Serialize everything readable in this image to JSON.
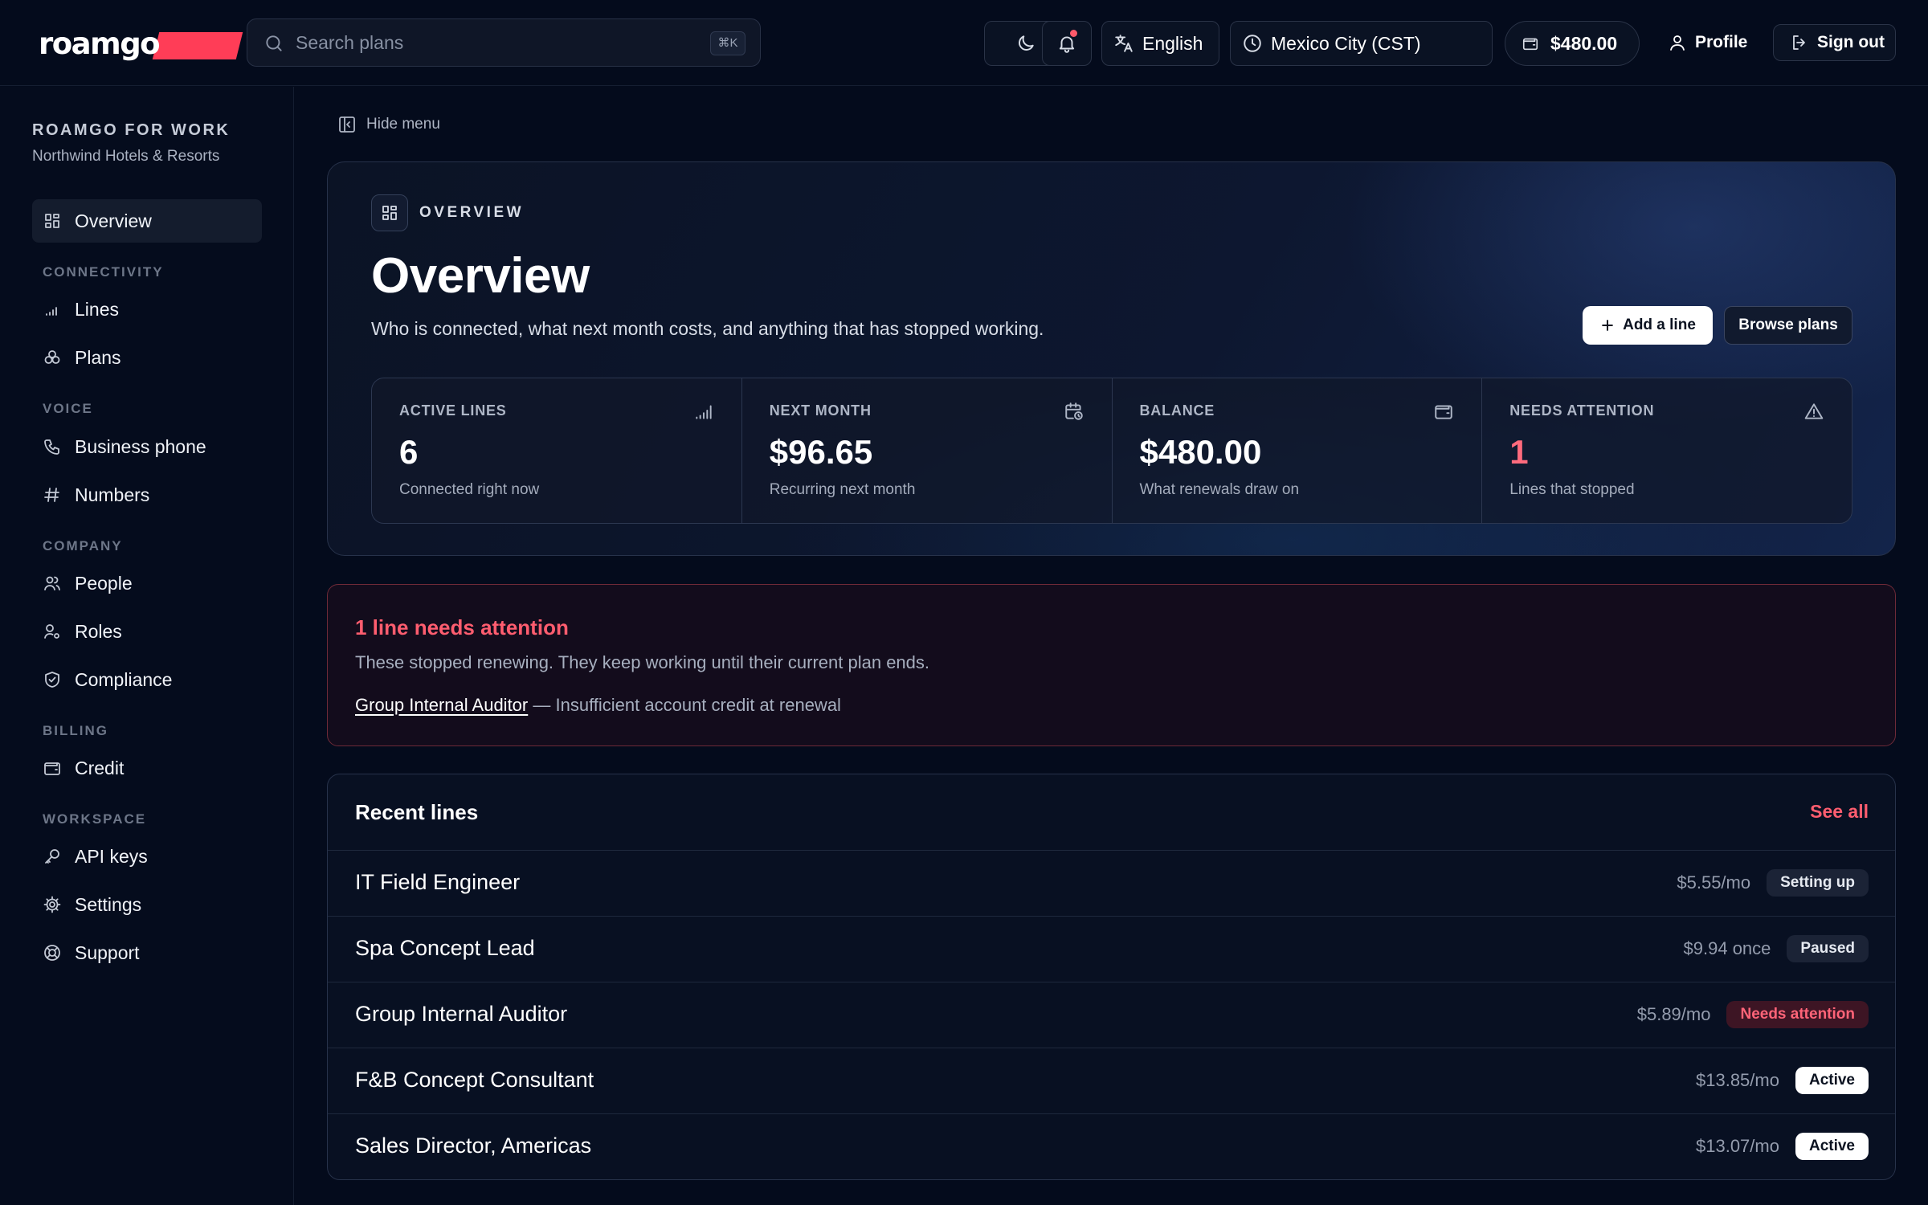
{
  "brand": {
    "logo_text": "roamgo",
    "accent": "#ff3d57"
  },
  "topbar": {
    "search_placeholder": "Search plans",
    "search_shortcut": "⌘K",
    "theme_toggle_icon": "moon-icon",
    "notifications_icon": "bell-icon",
    "language": "English",
    "timezone": "Mexico City (CST)",
    "balance": "$480.00",
    "profile_label": "Profile",
    "signout_label": "Sign out"
  },
  "sidebar": {
    "org_label": "ROAMGO FOR WORK",
    "org_name": "Northwind Hotels & Resorts",
    "overview": "Overview",
    "sections": {
      "connectivity": "CONNECTIVITY",
      "voice": "VOICE",
      "company": "COMPANY",
      "billing": "BILLING",
      "workspace": "WORKSPACE"
    },
    "items": {
      "lines": "Lines",
      "plans": "Plans",
      "business_phone": "Business phone",
      "numbers": "Numbers",
      "people": "People",
      "roles": "Roles",
      "compliance": "Compliance",
      "credit": "Credit",
      "api_keys": "API keys",
      "settings": "Settings",
      "support": "Support"
    }
  },
  "main": {
    "hide_menu": "Hide menu",
    "hero": {
      "eyebrow": "OVERVIEW",
      "title": "Overview",
      "subtitle": "Who is connected, what next month costs, and anything that has stopped working.",
      "add_line": "Add a line",
      "browse_plans": "Browse plans"
    },
    "stats": [
      {
        "label": "ACTIVE LINES",
        "value": "6",
        "caption": "Connected right now",
        "icon": "signal-icon"
      },
      {
        "label": "NEXT MONTH",
        "value": "$96.65",
        "caption": "Recurring next month",
        "icon": "calendar-clock-icon"
      },
      {
        "label": "BALANCE",
        "value": "$480.00",
        "caption": "What renewals draw on",
        "icon": "wallet-icon"
      },
      {
        "label": "NEEDS ATTENTION",
        "value": "1",
        "caption": "Lines that stopped",
        "icon": "warning-icon"
      }
    ],
    "alert": {
      "title": "1 line needs attention",
      "description": "These stopped renewing. They keep working until their current plan ends.",
      "line_name": "Group Internal Auditor",
      "line_reason": "— Insufficient account credit at renewal"
    },
    "recent": {
      "title": "Recent lines",
      "see_all": "See all",
      "rows": [
        {
          "name": "IT Field Engineer",
          "price": "$5.55/mo",
          "status": "Setting up"
        },
        {
          "name": "Spa Concept Lead",
          "price": "$9.94 once",
          "status": "Paused"
        },
        {
          "name": "Group Internal Auditor",
          "price": "$5.89/mo",
          "status": "Needs attention"
        },
        {
          "name": "F&B Concept Consultant",
          "price": "$13.85/mo",
          "status": "Active"
        },
        {
          "name": "Sales Director, Americas",
          "price": "$13.07/mo",
          "status": "Active"
        }
      ]
    }
  },
  "colors": {
    "background": "#040b1c",
    "danger": "#ff5d6f",
    "status_active": "#ffffff",
    "status_attention": "#ff6478"
  }
}
